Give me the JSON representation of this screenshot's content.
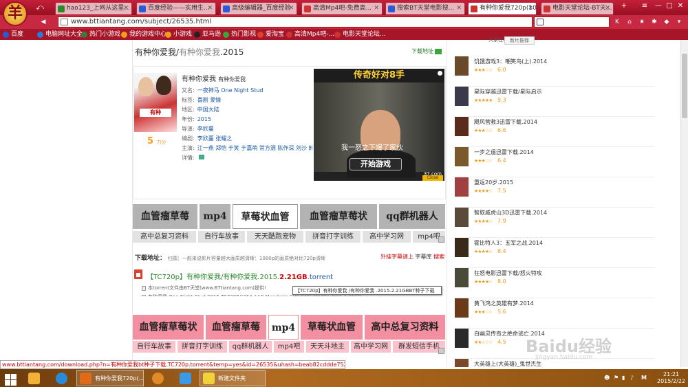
{
  "browser": {
    "tabs": [
      {
        "label": "hao123_上网从这里...",
        "active": false,
        "color": "#2a8a2a"
      },
      {
        "label": "百度经验——实用生...",
        "active": false,
        "color": "#2a5ad6"
      },
      {
        "label": "高级编辑器_百度经验",
        "active": false,
        "color": "#2a5ad6"
      },
      {
        "label": "高清Mp4吧-免费高...",
        "active": false,
        "color": "#c33"
      },
      {
        "label": "搜索BT天堂电影搜...",
        "active": false,
        "color": "#2a5ad6"
      },
      {
        "label": "有种你爱我720p(10...",
        "active": true,
        "color": "#c33"
      },
      {
        "label": "电影天堂论坛-BT天...",
        "active": false,
        "color": "#c33"
      }
    ],
    "address": "www.bttiantang.com/subject/26535.html",
    "bookmarks": [
      {
        "label": "百度",
        "color": "#2a5ad6"
      },
      {
        "label": "电脑网址大全",
        "color": "#2a7ad6"
      },
      {
        "label": "热门小游戏",
        "color": "#3a7a3a"
      },
      {
        "label": "我的游戏中心",
        "color": "#f29c1a"
      },
      {
        "label": "小游戏",
        "color": "#f29c1a"
      },
      {
        "label": "亚马逊",
        "color": "#222"
      },
      {
        "label": "热门影视",
        "color": "#3aa53a"
      },
      {
        "label": "爱淘宝",
        "color": "#e04030"
      },
      {
        "label": "高清Mp4吧-...",
        "color": "#c33"
      },
      {
        "label": "电影天堂论坛...",
        "color": "#c33"
      }
    ]
  },
  "page": {
    "title_main": "有种你爱我/",
    "title_alt": "有种你爱我",
    "title_year": ".2015",
    "download_link": "下载地址",
    "movie_name": "有种你爱我",
    "movie_name_small": "有种你爱我",
    "score": "5",
    "score_unit": "力分",
    "info": [
      {
        "label": "又名:",
        "value": "一夜神马 One Night Stud"
      },
      {
        "label": "标签:",
        "value": "喜剧 爱情"
      },
      {
        "label": "地区:",
        "value": "中国大陆"
      },
      {
        "label": "年份:",
        "value": "2015"
      },
      {
        "label": "导演:",
        "value": "李欣蔓"
      },
      {
        "label": "编剧:",
        "value": "李欣蔓 张耀之"
      },
      {
        "label": "主演:",
        "value": "江一燕 郑恺 于笑 于嘉萌 常方源 陈作深 刘沙 韩春..."
      },
      {
        "label": "详情:",
        "value": ""
      }
    ],
    "video": {
      "title": "传奇好对8手",
      "subtitle": "我一怒之下爆了家伙",
      "button": "开始游戏",
      "watermark": "37.com",
      "close": "Close"
    },
    "keywords_row1": [
      "血管瘤草莓",
      "mp4",
      "草莓状血管",
      "血管瘤草莓状",
      "qq群机器人"
    ],
    "keywords_row1b": [
      "高中总复习资料",
      "自行车故事",
      "天天酷跑宠物",
      "拼音打字训练",
      "高中学习网",
      "mp4吧"
    ],
    "download_title": "下载地址：",
    "download_hint": "扫圆：一般来说影片容量越大画质越清晰：1080p的画质绝对比720p清晰",
    "download_right_a": "外挂字幕请上",
    "download_right_b": "字幕库",
    "download_right_c": "搜索",
    "torrent_prefix": "【TC720p】有种你爱我/有种你爱我.2015.",
    "torrent_size": "2.21GB",
    "torrent_ext": ".torrent",
    "torrent_line1": "本torrent文件由BT天堂(www.BTtiantang.com)提供!",
    "torrent_line2": "有种爱我.One.Night.Stud.2015.TC720P.X264.AAC.Mandarin.CHS-ENG.Mp4Ba.mp4 2.21GB",
    "tooltip": "【TC720p】有种你爱我 /有种你爱我 .2015.2.21GBBT种子下载",
    "keywords_row2": [
      "血管瘤草莓状",
      "血管瘤草莓",
      "mp4",
      "草莓状血管",
      "高中总复习资料"
    ],
    "keywords_row2b": [
      "自行车故事",
      "拼音打字训练",
      "qq群机器人",
      "mp4吧",
      "天天斗地主",
      "高中学习网",
      "群发短信手机"
    ]
  },
  "sidebar": {
    "header": "大家在看",
    "tab": "新片推荐",
    "items": [
      {
        "title": "饥饿游戏3：嘲笑鸟(上).2014",
        "stars": "★★★☆☆",
        "score": "6.0",
        "color": "#6a4a2a"
      },
      {
        "title": "星际穿越迅雷下载/星际启示",
        "stars": "★★★★★",
        "score": "9.3",
        "color": "#3a3a4a"
      },
      {
        "title": "飓风营救3迅雷下载.2014",
        "stars": "★★★☆☆",
        "score": "6.6",
        "color": "#5a2a1a"
      },
      {
        "title": "一步之遥迅雷下载.2014",
        "stars": "★★★☆☆",
        "score": "6.4",
        "color": "#7a5a2a"
      },
      {
        "title": "重返20岁.2015",
        "stars": "★★★★☆",
        "score": "7.5",
        "color": "#a04040"
      },
      {
        "title": "智取威虎山3D迅雷下载.2014",
        "stars": "★★★★☆",
        "score": "7.9",
        "color": "#5a4a3a"
      },
      {
        "title": "霍比特人3：五军之战.2014",
        "stars": "★★★★☆",
        "score": "8.4",
        "color": "#3a2a1a"
      },
      {
        "title": "狂怒电影迅雷下载/怒火特攻",
        "stars": "★★★★☆",
        "score": "8.0",
        "color": "#4a4a3a"
      },
      {
        "title": "黄飞鸿之英雄有梦.2014",
        "stars": "★★★☆☆",
        "score": "5.6",
        "color": "#6a3a1a"
      },
      {
        "title": "白幽灵传奇之绝命逃亡.2014",
        "stars": "★★☆☆☆",
        "score": "4.5",
        "color": "#2a2a2a"
      },
      {
        "title": "大英雄上(大英雄)_鬼世杰生",
        "stars": "",
        "score": "",
        "color": "#7a4a2a"
      }
    ]
  },
  "watermark": {
    "main": "Baidu经验",
    "sub": "jingyan.baidu.com"
  },
  "status_url": "www.bttiantang.com/download.php?n=有种你爱我bt种子下载.TC720p.torrent&temp=yes&id=26535&uhash=beab82cddde752b7d2acd026",
  "taskbar": {
    "window1": "有种你爱我720p(...",
    "window2": "新建文件夹",
    "time": "21:21",
    "date": "2015/2/22",
    "ime": "M"
  }
}
